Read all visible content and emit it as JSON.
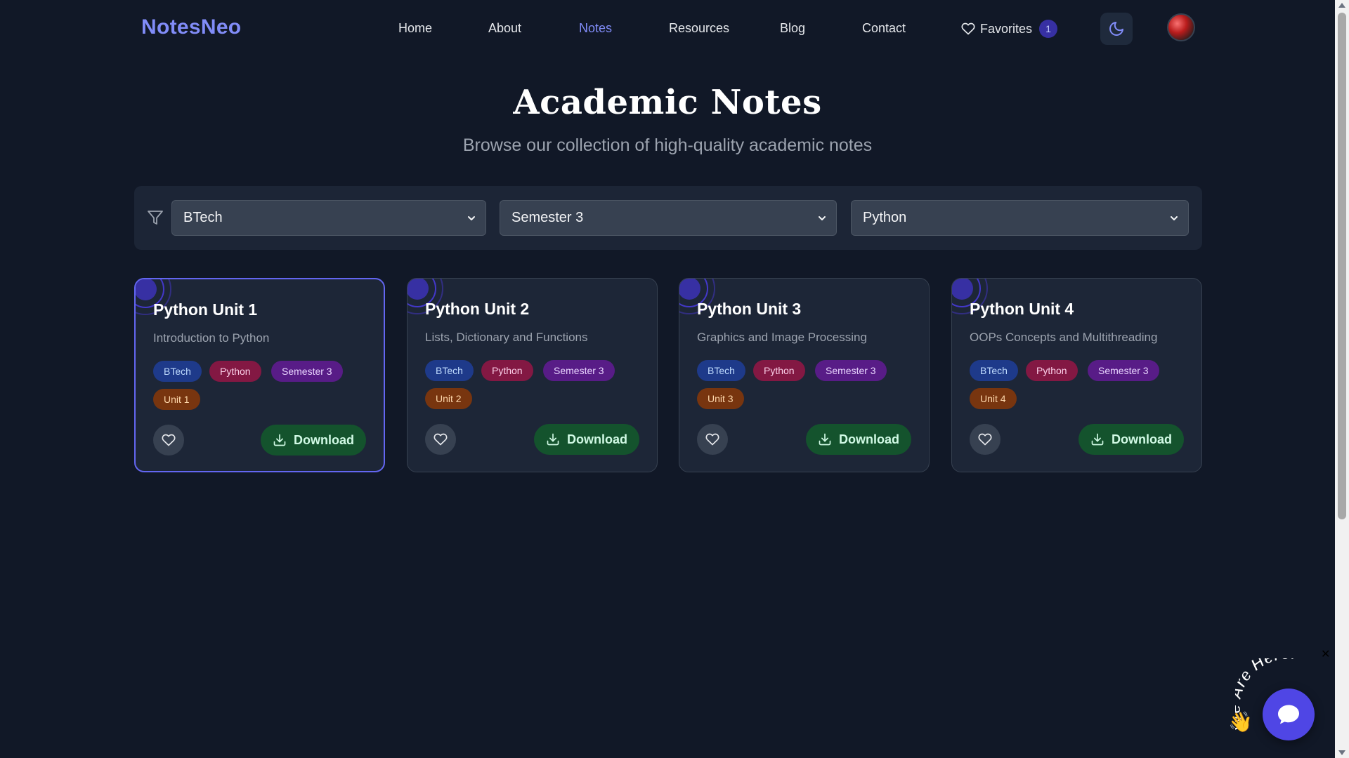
{
  "nav": {
    "logo": "NotesNeo",
    "links": [
      {
        "label": "Home",
        "active": false
      },
      {
        "label": "About",
        "active": false
      },
      {
        "label": "Notes",
        "active": true
      },
      {
        "label": "Resources",
        "active": false
      },
      {
        "label": "Blog",
        "active": false
      },
      {
        "label": "Contact",
        "active": false
      }
    ],
    "favorites_label": "Favorites",
    "favorites_count": "1",
    "theme_icon": "moon-icon",
    "avatar_icon": "user-avatar"
  },
  "header": {
    "title": "Academic Notes",
    "subtitle": "Browse our collection of high-quality academic notes"
  },
  "filters": {
    "program": "BTech",
    "semester": "Semester 3",
    "subject": "Python"
  },
  "cards": [
    {
      "title": "Python Unit 1",
      "description": "Introduction to Python",
      "tags": [
        "BTech",
        "Python",
        "Semester 3",
        "Unit 1"
      ],
      "download_label": "Download"
    },
    {
      "title": "Python Unit 2",
      "description": "Lists, Dictionary and Functions",
      "tags": [
        "BTech",
        "Python",
        "Semester 3",
        "Unit 2"
      ],
      "download_label": "Download"
    },
    {
      "title": "Python Unit 3",
      "description": "Graphics and Image Processing",
      "tags": [
        "BTech",
        "Python",
        "Semester 3",
        "Unit 3"
      ],
      "download_label": "Download"
    },
    {
      "title": "Python Unit 4",
      "description": "OOPs Concepts and Multithreading",
      "tags": [
        "BTech",
        "Python",
        "Semester 3",
        "Unit 4"
      ],
      "download_label": "Download"
    }
  ],
  "chat": {
    "label": "We Are Here!"
  },
  "colors": {
    "background": "#111827",
    "accent": "#818cf8",
    "download": "#14532d",
    "card": "#1d2637"
  }
}
